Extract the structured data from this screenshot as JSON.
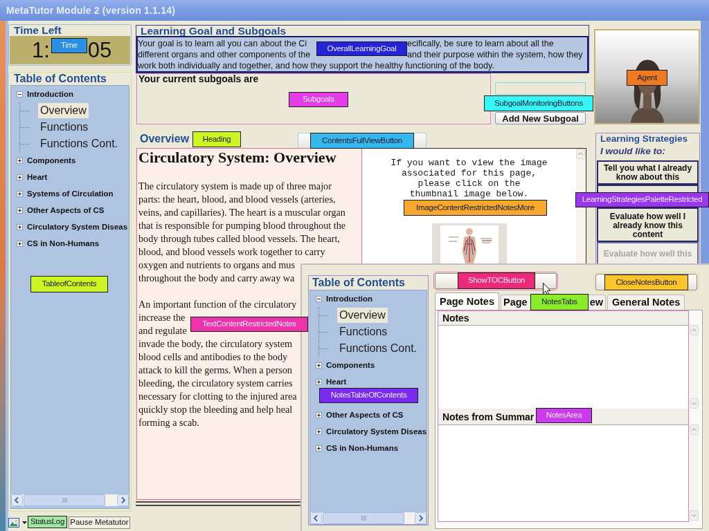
{
  "window": {
    "title": "MetaTutor Module 2 (version 1.1.14)"
  },
  "timer": {
    "title": "Time Left",
    "value_parts": [
      "1:",
      "05"
    ]
  },
  "table_of_contents": {
    "title": "Table of Contents",
    "items": [
      {
        "label": "Introduction",
        "expanded": true,
        "selected": false,
        "children": [
          {
            "label": "Overview",
            "selected": true
          },
          {
            "label": "Functions",
            "selected": false
          },
          {
            "label": "Functions Cont.",
            "selected": false
          }
        ]
      },
      {
        "label": "Components",
        "expanded": false,
        "selected": false
      },
      {
        "label": "Heart",
        "expanded": false,
        "selected": false
      },
      {
        "label": "Systems of Circulation",
        "expanded": false,
        "selected": false
      },
      {
        "label": "Other Aspects of CS",
        "expanded": false,
        "selected": false
      },
      {
        "label": "Circulatory System Diseas",
        "expanded": false,
        "selected": false
      },
      {
        "label": "CS in Non-Humans",
        "expanded": false,
        "selected": false
      }
    ]
  },
  "status_bar": {
    "pause_button": "Pause Metatutor"
  },
  "learning_goal": {
    "title": "Learning Goal and Subgoals",
    "goal_lines": [
      [
        "Your goal is to learn all you can about the Ci",
        "ecifically, be sure to learn about all the"
      ],
      [
        "different organs and other components of the",
        "and their purpose within the system, how they"
      ],
      [
        "work both individually and together, and how they support the healthy functioning of the body."
      ]
    ],
    "subgoals_heading": "Your current subgoals are",
    "add_subgoal_button": "Add New Subgoal"
  },
  "content": {
    "section_title": "Overview",
    "page_title": "Circulatory System: Overview",
    "paragraphs": [
      [
        "The circulatory system is made up of three major",
        "parts: the heart, blood, and blood vessels (arteries,",
        "veins, and capillaries). The heart is a muscular organ",
        "that is responsible for pumping blood throughout the",
        "body through tubes called blood vessels. The heart,",
        "blood, and blood vessels work together to carry",
        "oxygen and nutrients to organs and mus",
        "throughout the body and carry away wa"
      ],
      [
        "An important function of the circulatory",
        "increase the",
        "and regulate",
        "invade the body, the circulatory system",
        "blood cells and antibodies to the body",
        "attack to kill the germs. When a person",
        "bleeding, the circulatory system carries",
        "necessary for clotting to the injured area",
        "quickly stop the bleeding and help heal",
        "forming a scab."
      ]
    ],
    "image_prompt": [
      "If you want to view the image",
      "associated for this page,",
      "please click on the",
      "thumbnail image below."
    ]
  },
  "learning_strategies": {
    "title": "Learning Strategies",
    "prompt": "I would like to:",
    "buttons": [
      {
        "label": "Tell you what I already know about this",
        "disabled": false
      },
      {
        "disabled": false
      },
      {
        "label": "Evaluate how well I already know this content",
        "disabled": false
      },
      {
        "label": "Evaluate how well this",
        "disabled": true
      }
    ]
  },
  "notes_window": {
    "table_of_contents": {
      "title": "Table of Contents",
      "items": [
        {
          "kind": "topic",
          "label": "Introduction",
          "expanded": true,
          "selected": false,
          "children": [
            {
              "label": "Overview",
              "selected": true
            },
            {
              "label": "Functions",
              "selected": false
            },
            {
              "label": "Functions Cont.",
              "selected": false
            }
          ]
        },
        {
          "kind": "topic",
          "label": "Components",
          "expanded": false,
          "selected": false
        },
        {
          "kind": "topic",
          "label": "Heart",
          "expanded": false,
          "selected": false
        },
        {
          "kind": "covered"
        },
        {
          "kind": "topic",
          "label": "Other Aspects of CS",
          "expanded": false,
          "selected": false
        },
        {
          "kind": "topic",
          "label": "Circulatory System Diseas",
          "expanded": false,
          "selected": false
        },
        {
          "kind": "topic",
          "label": "CS in Non-Humans",
          "expanded": false,
          "selected": false
        }
      ]
    },
    "tabs": [
      {
        "label": "Page Notes",
        "selected": true
      },
      {
        "label": "Page",
        "label_end": "ew",
        "selected": false
      },
      {
        "label": "General Notes",
        "selected": false
      }
    ],
    "sections": [
      {
        "title": "Notes"
      },
      {
        "title": "Notes from Summar"
      }
    ]
  },
  "annotations": [
    {
      "label": "Time",
      "color": "#2b8fe3"
    },
    {
      "label": "OverallLearningGoal",
      "color": "#2323d8"
    },
    {
      "label": "Agent",
      "color": "#ee7a22"
    },
    {
      "label": "Subgoals",
      "color": "#e23de6"
    },
    {
      "label": "SubgoalMonitoringButtons",
      "color": "#35f5f5"
    },
    {
      "label": "Heading",
      "color": "#ccf522"
    },
    {
      "label": "ContentsFullViewButton",
      "color": "#36b8ee"
    },
    {
      "label": "ImageContentRestrictedNotesMore",
      "color": "#f7a92e"
    },
    {
      "label": "LearningStrategiesPaletteRestricted",
      "color": "#9a36ee"
    },
    {
      "label": "TableofContents",
      "color": "#ccf522"
    },
    {
      "label": "ShowTOCButton",
      "color": "#ec2a78"
    },
    {
      "label": "CloseNotesButton",
      "color": "#fbc52a"
    },
    {
      "label": "NotesTabs",
      "color": "#8aec2a"
    },
    {
      "label": "TextContentRestrictedNotes",
      "color": "#ee33aa"
    },
    {
      "label": "NotesTableOfContents",
      "color": "#7a2bf0"
    },
    {
      "label": "NotesArea",
      "color": "#cc3aee"
    },
    {
      "label": "StatusLog",
      "color": "#a0e8a0"
    }
  ]
}
